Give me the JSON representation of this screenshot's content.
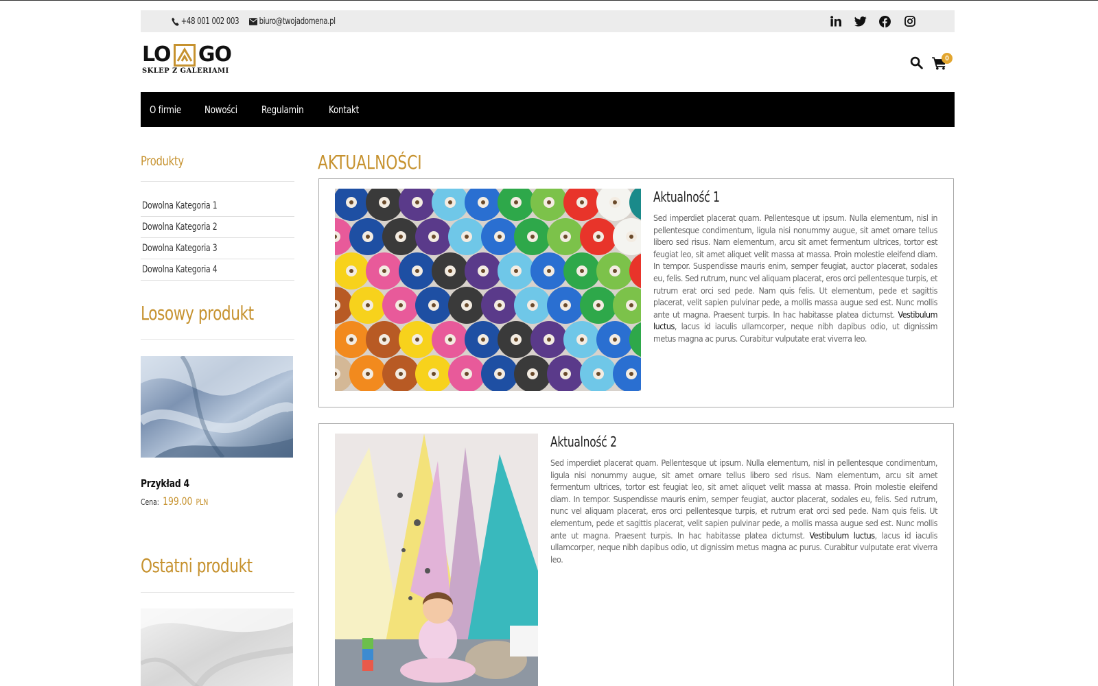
{
  "contact": {
    "phone": "+48 001 002 003",
    "email": "biuro@twojadomena.pl"
  },
  "socials": [
    "linkedin-icon",
    "twitter-icon",
    "facebook-icon",
    "instagram-icon"
  ],
  "logo": {
    "left": "LO",
    "right": "GO",
    "subtitle": "SKLEP Z GALERIAMI",
    "accent": "#c6922f"
  },
  "cart": {
    "count": "0"
  },
  "nav": {
    "items": [
      "O firmie",
      "Nowości",
      "Regulamin",
      "Kontakt"
    ]
  },
  "sidebar": {
    "products_heading": "Produkty",
    "categories": [
      "Dowolna Kategoria 1",
      "Dowolna Kategoria 2",
      "Dowolna Kategoria 3",
      "Dowolna Kategoria 4"
    ],
    "random_heading": "Losowy produkt",
    "random_product": {
      "name": "Przykład 4",
      "price_label": "Cena:",
      "price": "199.00",
      "currency": "PLN"
    },
    "last_heading": "Ostatni produkt"
  },
  "main": {
    "title": "AKTUALNOŚCI",
    "news": [
      {
        "title": "Aktualność 1",
        "text_before": "Sed imperdiet placerat quam. Pellentesque ut ipsum. Nulla elementum, nisl in pellentesque condimentum, ligula nisi nonummy augue, sit amet ornare tellus libero sed risus. Nam elementum, arcu sit amet fermentum ultrices, tortor est feugiat leo, sit amet aliquet velit massa at massa. Proin molestie eleifend diam. In tempor. Suspendisse mauris enim, semper feugiat, auctor placerat, sodales eu, felis. Sed rutrum, nunc vel aliquam placerat, eros orci pellentesque turpis, et rutrum erat orci sed pede. Nam quis felis. Ut elementum, pede et sagittis placerat, velit sapien pulvinar pede, a mollis massa augue sed est. Nunc mollis ante ut magna. Praesent turpis. In hac habitasse platea dictumst. ",
        "link": "Vestibulum luctus",
        "text_after": ", lacus id iaculis ullamcorper, neque nibh dapibus odio, ut dignissim metus magna ac purus. Curabitur vulputate erat viverra leo."
      },
      {
        "title": "Aktualność 2",
        "text_before": "Sed imperdiet placerat quam. Pellentesque ut ipsum. Nulla elementum, nisl in pellentesque condimentum, ligula nisi nonummy augue, sit amet ornare tellus libero sed risus. Nam elementum, arcu sit amet fermentum ultrices, tortor est feugiat leo, sit amet aliquet velit massa at massa. Proin molestie eleifend diam. In tempor. Suspendisse mauris enim, semper feugiat, auctor placerat, sodales eu, felis. Sed rutrum, nunc vel aliquam placerat, eros orci pellentesque turpis, et rutrum erat orci sed pede. Nam quis felis. Ut elementum, pede et sagittis placerat, velit sapien pulvinar pede, a mollis massa augue sed est. Nunc mollis ante ut magna. Praesent turpis. In hac habitasse platea dictumst. ",
        "link": "Vestibulum luctus",
        "text_after": ", lacus id iaculis ullamcorper, neque nibh dapibus odio, ut dignissim metus magna ac purus. Curabitur vulputate erat viverra leo."
      }
    ]
  }
}
